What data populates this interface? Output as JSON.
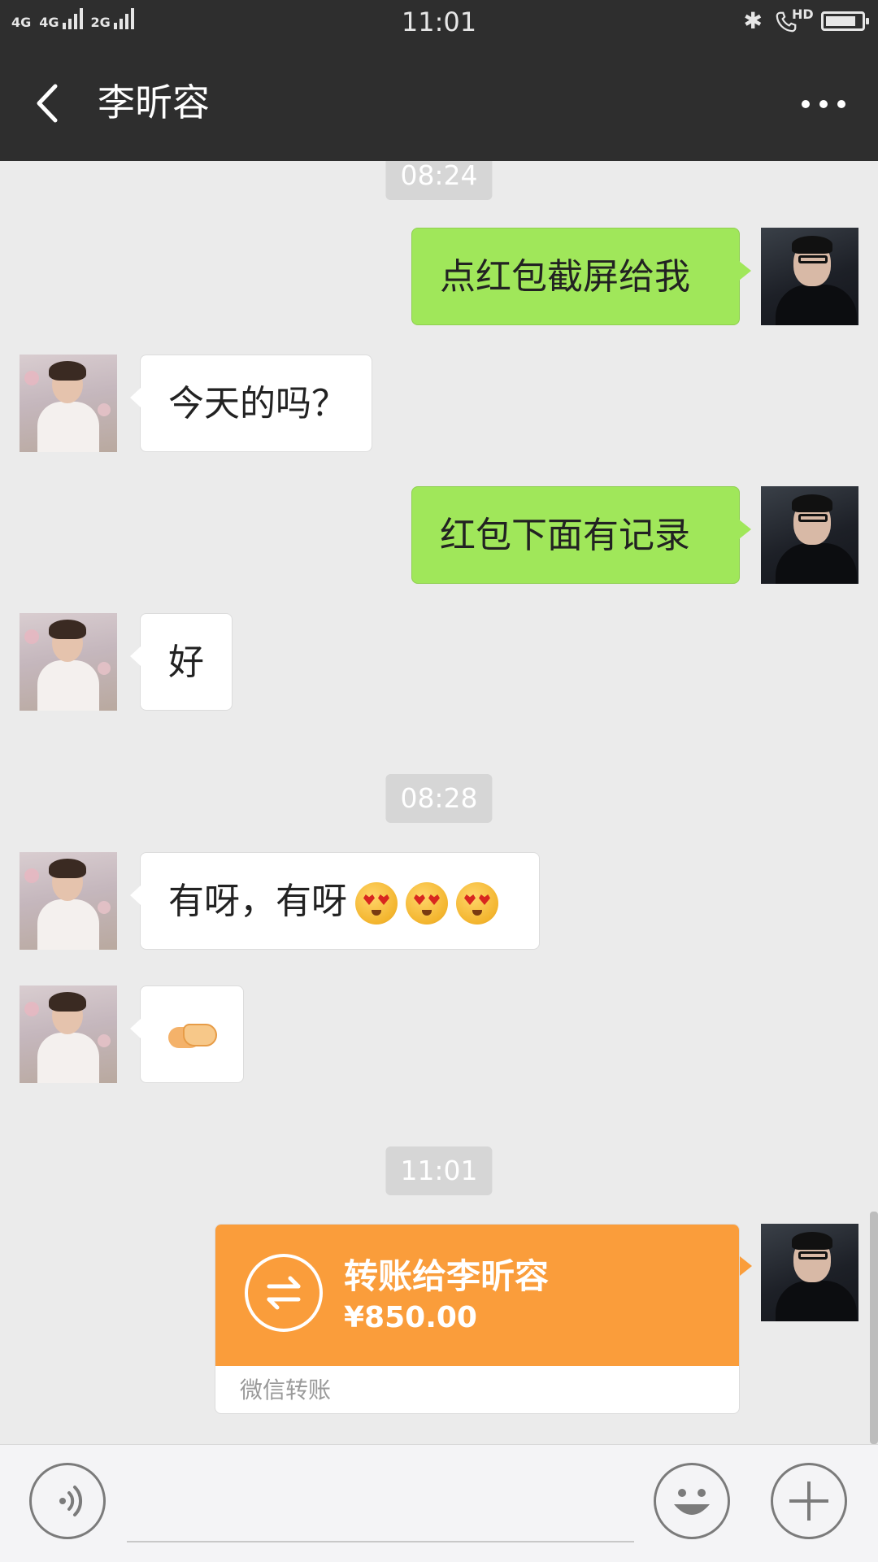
{
  "status_bar": {
    "network_left": "4G",
    "network_mid": "4G",
    "network_2g": "2G",
    "time": "11:01",
    "hd_label": "HD",
    "battery_level": 0.85
  },
  "header": {
    "title": "李昕容"
  },
  "chat": {
    "timestamps": [
      "08:24",
      "08:28",
      "11:01"
    ],
    "messages": [
      {
        "side": "out",
        "text": "点红包截屏给我"
      },
      {
        "side": "in",
        "text": "今天的吗？"
      },
      {
        "side": "out",
        "text": "红包下面有记录"
      },
      {
        "side": "in",
        "text": "好"
      },
      {
        "side": "in",
        "text": "有呀，有呀",
        "emoji": [
          "heart-eyes-face",
          "heart-eyes-face",
          "heart-eyes-face"
        ]
      },
      {
        "side": "in",
        "emoji": [
          "handshake"
        ]
      }
    ],
    "transfer": {
      "title": "转账给李昕容",
      "amount": "¥850.00",
      "footer": "微信转账",
      "color": "#fa9d3b"
    }
  },
  "colors": {
    "header_bg": "#2e2e2e",
    "chat_bg": "#ebebeb",
    "out_bubble": "#a0e75a",
    "in_bubble": "#ffffff"
  }
}
